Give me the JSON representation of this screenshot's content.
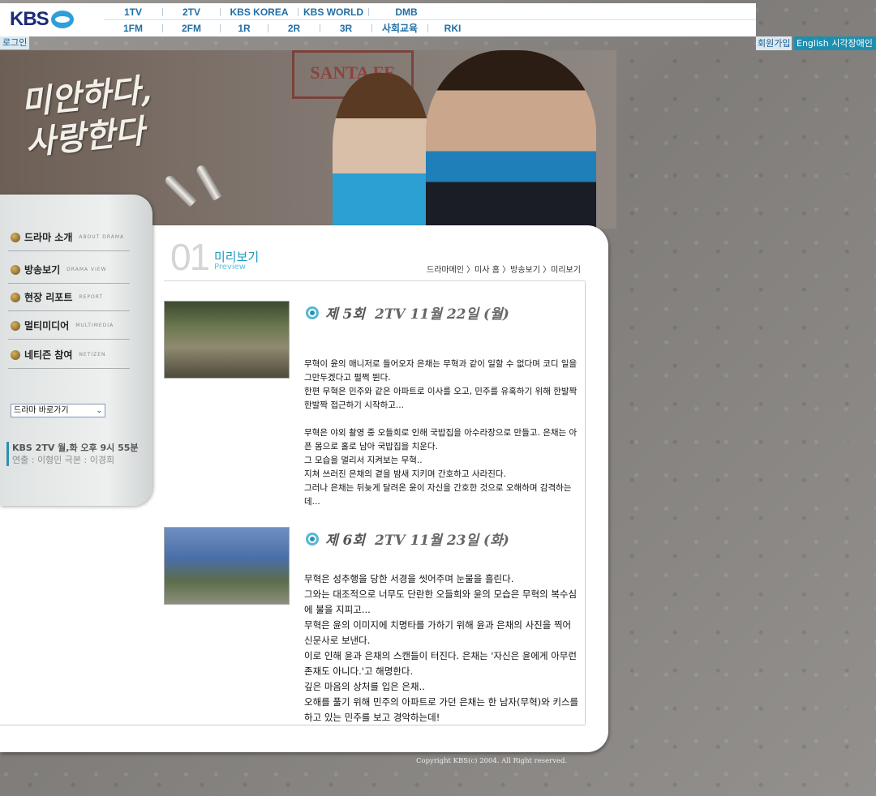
{
  "header": {
    "logo": "KBS",
    "nav_top": [
      "1TV",
      "2TV",
      "KBS KOREA",
      "KBS WORLD",
      "DMB"
    ],
    "nav_bottom": [
      "1FM",
      "2FM",
      "1R",
      "2R",
      "3R",
      "사회교육",
      "RKI"
    ],
    "login": "로그인",
    "signup": "회원가입",
    "english": "English 시각장애인"
  },
  "hero": {
    "title_line1": "미안하다,",
    "title_line2": "사랑한다",
    "sign_text": "SANTA FE"
  },
  "sidebar": {
    "menu": [
      {
        "ko": "드라마 소개",
        "en": "ABOUT DRAMA"
      },
      {
        "ko": "방송보기",
        "en": "DRAMA VIEW"
      },
      {
        "ko": "현장 리포트",
        "en": "REPORT"
      },
      {
        "ko": "멀티미디어",
        "en": "MULTIMEDIA"
      },
      {
        "ko": "네티즌 참여",
        "en": "NETIZEN"
      }
    ],
    "quick_select": "드라마 바로가기",
    "broadcast": "KBS 2TV 월,화 오후 9시 55분",
    "credits": "연출 : 이형민  극본 : 이경희"
  },
  "main": {
    "page_no": "01",
    "title": "미리보기",
    "title_en": "Preview",
    "breadcrumb": "드라마메인 〉미사 홈 〉방송보기 〉미리보기",
    "episodes": [
      {
        "num": "제 5회",
        "date": "2TV 11월 22일 (월)",
        "paragraphs": [
          "무혁이 윤의 매니저로 들어오자 은채는 무혁과 같이 일할 수 없다며 코디 일을 그만두겠다고 펄쩍 뛴다.",
          "한편 무혁은 민주와 같은 아파트로 이사를 오고, 민주를 유혹하기 위해 한발짝 한발짝 접근하기 시작하고...",
          "",
          "무혁은 야외 촬영 중 오들희로 인해 국밥집을 아수라장으로 만들고. 은채는 아픈 몸으로 홀로 남아 국밥집을 치운다.",
          "그 모습을 멀리서 지켜보는 무혁..",
          "지쳐 쓰러진 은채의 곁을 밤새 지키며 간호하고 사라진다.",
          "그러나 은채는 뒤늦게 달려온 윤이 자신을 간호한 것으로 오해하며 감격하는데..."
        ]
      },
      {
        "num": "제 6회",
        "date": "2TV 11월 23일 (화)",
        "paragraphs": [
          "무혁은 성추행을 당한 서경을 씻어주며 눈물을 흘린다.",
          "그와는 대조적으로 너무도 단란한 오들희와 윤의 모습은 무혁의 복수심에 불을 지피고...",
          "무혁은 윤의 이미지에 치명타를 가하기 위해 윤과 은채의 사진을 찍어 신문사로 보낸다.",
          "이로 인해 윤과 은채의 스캔들이 터진다. 은채는 '자신은 윤에게 아무런 존재도 아니다.'고 해명한다.",
          "깊은 마음의 상처를 입은 은채..",
          "오해를 풀기 위해 민주의 아파트로 가던 은채는 한 남자(무혁)와 키스를 하고 있는 민주를 보고 경악하는데!"
        ]
      }
    ]
  },
  "footer": {
    "copyright": "Copyright KBS(c) 2004. All Right reserved."
  },
  "colors": {
    "accent": "#1d9ac0",
    "nav": "#1f6fa6",
    "english_bg": "#1d8fb0"
  }
}
